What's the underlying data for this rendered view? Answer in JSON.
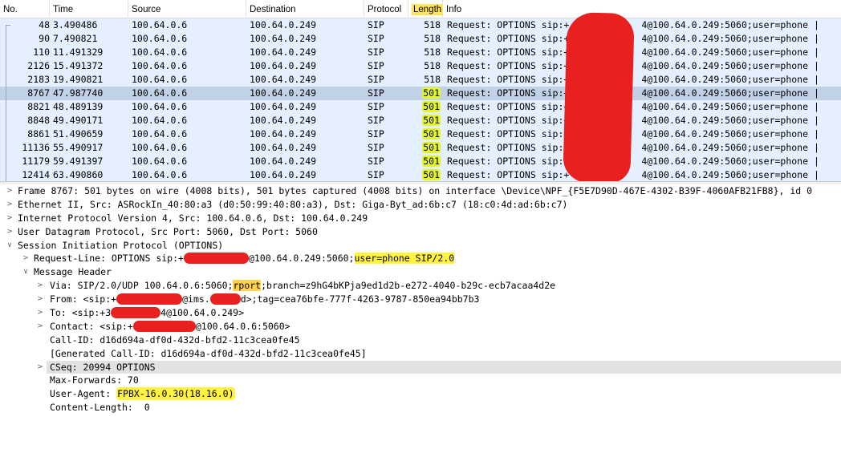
{
  "packet_list": {
    "columns": [
      "No.",
      "Time",
      "Source",
      "Destination",
      "Protocol",
      "Length",
      "Info"
    ],
    "rows": [
      {
        "no": "48",
        "time": "3.490486",
        "src": "100.64.0.6",
        "dst": "100.64.0.249",
        "proto": "SIP",
        "len": "518",
        "info": "Request: OPTIONS sip:+             4@100.64.0.249:5060;user=phone |"
      },
      {
        "no": "90",
        "time": "7.490821",
        "src": "100.64.0.6",
        "dst": "100.64.0.249",
        "proto": "SIP",
        "len": "518",
        "info": "Request: OPTIONS sip:+             4@100.64.0.249:5060;user=phone |"
      },
      {
        "no": "110",
        "time": "11.491329",
        "src": "100.64.0.6",
        "dst": "100.64.0.249",
        "proto": "SIP",
        "len": "518",
        "info": "Request: OPTIONS sip:+             4@100.64.0.249:5060;user=phone |"
      },
      {
        "no": "2126",
        "time": "15.491372",
        "src": "100.64.0.6",
        "dst": "100.64.0.249",
        "proto": "SIP",
        "len": "518",
        "info": "Request: OPTIONS sip:+             4@100.64.0.249:5060;user=phone |"
      },
      {
        "no": "2183",
        "time": "19.490821",
        "src": "100.64.0.6",
        "dst": "100.64.0.249",
        "proto": "SIP",
        "len": "518",
        "info": "Request: OPTIONS sip:+             4@100.64.0.249:5060;user=phone |"
      },
      {
        "no": "8767",
        "time": "47.987740",
        "src": "100.64.0.6",
        "dst": "100.64.0.249",
        "proto": "SIP",
        "len": "501",
        "info": "Request: OPTIONS sip:+             4@100.64.0.249:5060;user=phone |"
      },
      {
        "no": "8821",
        "time": "48.489139",
        "src": "100.64.0.6",
        "dst": "100.64.0.249",
        "proto": "SIP",
        "len": "501",
        "info": "Request: OPTIONS sip:+             4@100.64.0.249:5060;user=phone |"
      },
      {
        "no": "8848",
        "time": "49.490171",
        "src": "100.64.0.6",
        "dst": "100.64.0.249",
        "proto": "SIP",
        "len": "501",
        "info": "Request: OPTIONS sip:+             4@100.64.0.249:5060;user=phone |"
      },
      {
        "no": "8861",
        "time": "51.490659",
        "src": "100.64.0.6",
        "dst": "100.64.0.249",
        "proto": "SIP",
        "len": "501",
        "info": "Request: OPTIONS sip:+             4@100.64.0.249:5060;user=phone |"
      },
      {
        "no": "11136",
        "time": "55.490917",
        "src": "100.64.0.6",
        "dst": "100.64.0.249",
        "proto": "SIP",
        "len": "501",
        "info": "Request: OPTIONS sip:+             4@100.64.0.249:5060;user=phone |"
      },
      {
        "no": "11179",
        "time": "59.491397",
        "src": "100.64.0.6",
        "dst": "100.64.0.249",
        "proto": "SIP",
        "len": "501",
        "info": "Request: OPTIONS sip:+             4@100.64.0.249:5060;user=phone |"
      },
      {
        "no": "12414",
        "time": "63.490860",
        "src": "100.64.0.6",
        "dst": "100.64.0.249",
        "proto": "SIP",
        "len": "501",
        "info": "Request: OPTIONS sip:+             4@100.64.0.249:5060;user=phone |"
      }
    ],
    "selected_no": "8767"
  },
  "details": {
    "frame": "Frame 8767: 501 bytes on wire (4008 bits), 501 bytes captured (4008 bits) on interface \\Device\\NPF_{F5E7D90D-467E-4302-B39F-4060AFB21FB8}, id 0",
    "ethernet": "Ethernet II, Src: ASRockIn_40:80:a3 (d0:50:99:40:80:a3), Dst: Giga-Byt_ad:6b:c7 (18:c0:4d:ad:6b:c7)",
    "ip": "Internet Protocol Version 4, Src: 100.64.0.6, Dst: 100.64.0.249",
    "udp": "User Datagram Protocol, Src Port: 5060, Dst Port: 5060",
    "sip": "Session Initiation Protocol (OPTIONS)",
    "request_line_a": "Request-Line: OPTIONS sip:+",
    "request_line_b": "@100.64.0.249:5060;",
    "request_line_hl": "user=phone SIP/2.0",
    "message_header": "Message Header",
    "via_a": "Via: SIP/2.0/UDP 100.64.0.6:5060;",
    "via_hl": "rport",
    "via_b": ";branch=z9hG4bKPja9ed1d2b-e272-4040-b29c-ecb7acaa4d2e",
    "from_a": "From: <sip:+",
    "from_b": "@ims.",
    "from_c": "d>;tag=cea76bfe-777f-4263-9787-850ea94bb7b3",
    "to_a": "To: <sip:+3",
    "to_b": "4@100.64.0.249>",
    "contact_a": "Contact: <sip:+",
    "contact_b": "@100.64.0.6:5060>",
    "call_id": "Call-ID: d16d694a-df0d-432d-bfd2-11c3cea0fe45",
    "generated_call_id": "[Generated Call-ID: d16d694a-df0d-432d-bfd2-11c3cea0fe45]",
    "cseq": "CSeq: 20994 OPTIONS",
    "max_forwards": "Max-Forwards: 70",
    "user_agent_label": "User-Agent: ",
    "user_agent_value": "FPBX-16.0.30(18.16.0)",
    "content_length": "Content-Length:  0"
  },
  "colors": {
    "row_bg": "#e4efff",
    "selected_bg": "#c2d2e6",
    "highlight": "#fff33f",
    "redaction": "#e8201f"
  }
}
